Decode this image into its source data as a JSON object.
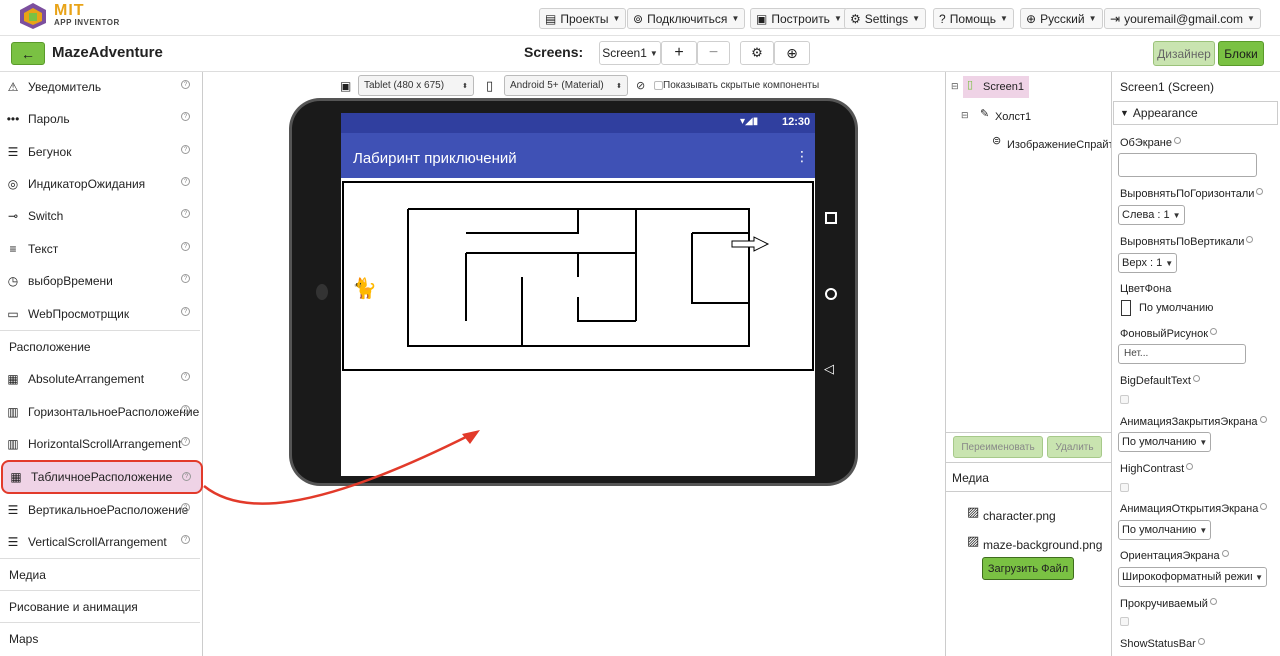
{
  "topbar": {
    "logo_mit": "MIT",
    "logo_sub": "APP INVENTOR",
    "menu": [
      {
        "label": "Проекты",
        "icon": "folder-icon"
      },
      {
        "label": "Подключиться",
        "icon": "wifi-icon"
      },
      {
        "label": "Построить",
        "icon": "build-icon"
      },
      {
        "label": "Settings",
        "icon": "gear-icon"
      },
      {
        "label": "Помощь",
        "icon": "help-icon"
      },
      {
        "label": "Русский",
        "icon": "globe-icon"
      },
      {
        "label": "youremail@gmail.com",
        "icon": "login-icon"
      }
    ]
  },
  "projectbar": {
    "back": "←",
    "project_name": "MazeAdventure",
    "screens_label": "Screens:",
    "screen_select": "Screen1",
    "add": "+",
    "remove": "−",
    "designer": "Дизайнер",
    "blocks": "Блоки"
  },
  "palette": {
    "items": [
      {
        "label": "Уведомитель",
        "icon": "warning-icon"
      },
      {
        "label": "Пароль",
        "icon": "password-icon"
      },
      {
        "label": "Бегунок",
        "icon": "slider-icon"
      },
      {
        "label": "ИндикаторОжидания",
        "icon": "spinner-icon"
      },
      {
        "label": "Switch",
        "icon": "switch-icon"
      },
      {
        "label": "Текст",
        "icon": "text-icon"
      },
      {
        "label": "выборВремени",
        "icon": "clock-icon"
      },
      {
        "label": "WebПросмотрщик",
        "icon": "webview-icon"
      }
    ],
    "category_layout": "Расположение",
    "layout_items": [
      {
        "label": "AbsoluteArrangement",
        "icon": "grid-icon"
      },
      {
        "label": "ГоризонтальноеРасположение",
        "icon": "columns-icon"
      },
      {
        "label": "HorizontalScrollArrangement",
        "icon": "columns-icon"
      },
      {
        "label": "ТабличноеРасположение",
        "icon": "grid-icon"
      },
      {
        "label": "ВертикальноеРасположение",
        "icon": "rows-icon"
      },
      {
        "label": "VerticalScrollArrangement",
        "icon": "rows-icon"
      }
    ],
    "categories_bottom": [
      "Медиа",
      "Рисование и анимация",
      "Maps"
    ]
  },
  "viewer": {
    "size_select": "Tablet (480 x 675)",
    "theme_select": "Android 5+ (Material)",
    "show_hidden": "Показывать скрытые компоненты",
    "phone": {
      "time": "12:30",
      "app_title": "Лабиринт приключений",
      "appbar_color": "#3f51b5"
    }
  },
  "tree": {
    "screen": "Screen1",
    "canvas": "Холст1",
    "sprite": "ИзображениеСпрайт",
    "rename": "Переименовать",
    "delete": "Удалить",
    "media_label": "Медиа",
    "media": [
      "character.png",
      "maze-background.png"
    ],
    "upload": "Загрузить Файл"
  },
  "props": {
    "header": "Screen1 (Screen)",
    "section": "Appearance",
    "about_label": "ОбЭкране",
    "halign_label": "ВыровнятьПоГоризонтали",
    "halign_value": "Слева : 1",
    "valign_label": "ВыровнятьПоВертикали",
    "valign_value": "Верх : 1",
    "bgcolor_label": "ЦветФона",
    "bgcolor_value": "По умолчанию",
    "bgimage_label": "ФоновыйРисунок",
    "bgimage_value": "Нет...",
    "bigtext_label": "BigDefaultText",
    "closeanim_label": "АнимацияЗакрытияЭкрана",
    "closeanim_value": "По умолчанию",
    "contrast_label": "HighContrast",
    "openanim_label": "АнимацияОткрытияЭкрана",
    "openanim_value": "По умолчанию",
    "orientation_label": "ОриентацияЭкрана",
    "orientation_value": "Широкоформатный режим",
    "scroll_label": "Прокручиваемый",
    "statusbar_label": "ShowStatusBar"
  },
  "colors": {
    "accent_green": "#7ac143",
    "highlight_red": "#e23a2a",
    "selected_pink": "#efd3e6"
  }
}
